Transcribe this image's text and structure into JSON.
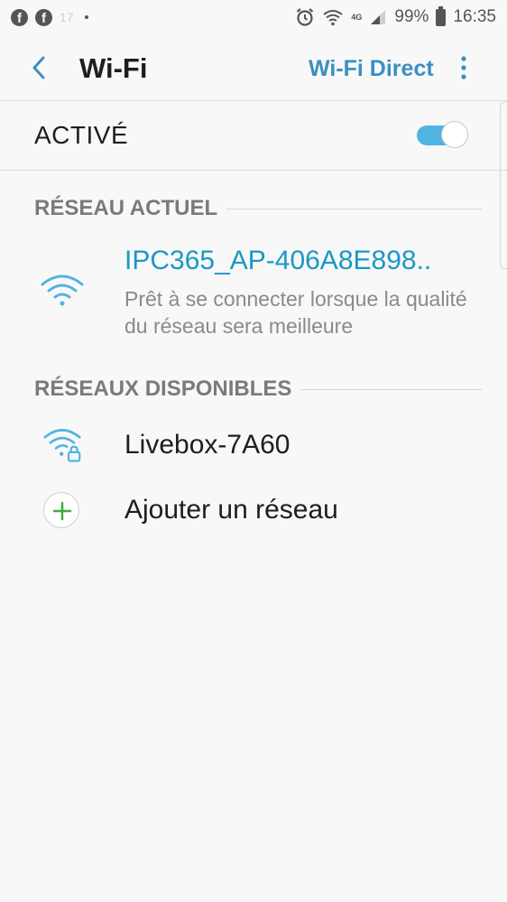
{
  "status_bar": {
    "notification_number": "17",
    "signal_type": "4G",
    "battery": "99%",
    "time": "16:35"
  },
  "header": {
    "title": "Wi-Fi",
    "wifi_direct_label": "Wi-Fi Direct"
  },
  "wifi_toggle": {
    "label": "ACTIVÉ",
    "enabled": true
  },
  "current_network": {
    "section_label": "RÉSEAU ACTUEL",
    "name": "IPC365_AP-406A8E898..",
    "status": "Prêt à se connecter lorsque la qualité du réseau sera meilleure"
  },
  "available_networks": {
    "section_label": "RÉSEAUX DISPONIBLES",
    "items": [
      {
        "name": "Livebox-7A60",
        "secured": true
      }
    ],
    "add_network_label": "Ajouter un réseau"
  },
  "colors": {
    "accent": "#3c8fc0",
    "current_network_name": "#1a98c4",
    "toggle_on": "#4fb5e0",
    "add_icon": "#3cae3c"
  }
}
